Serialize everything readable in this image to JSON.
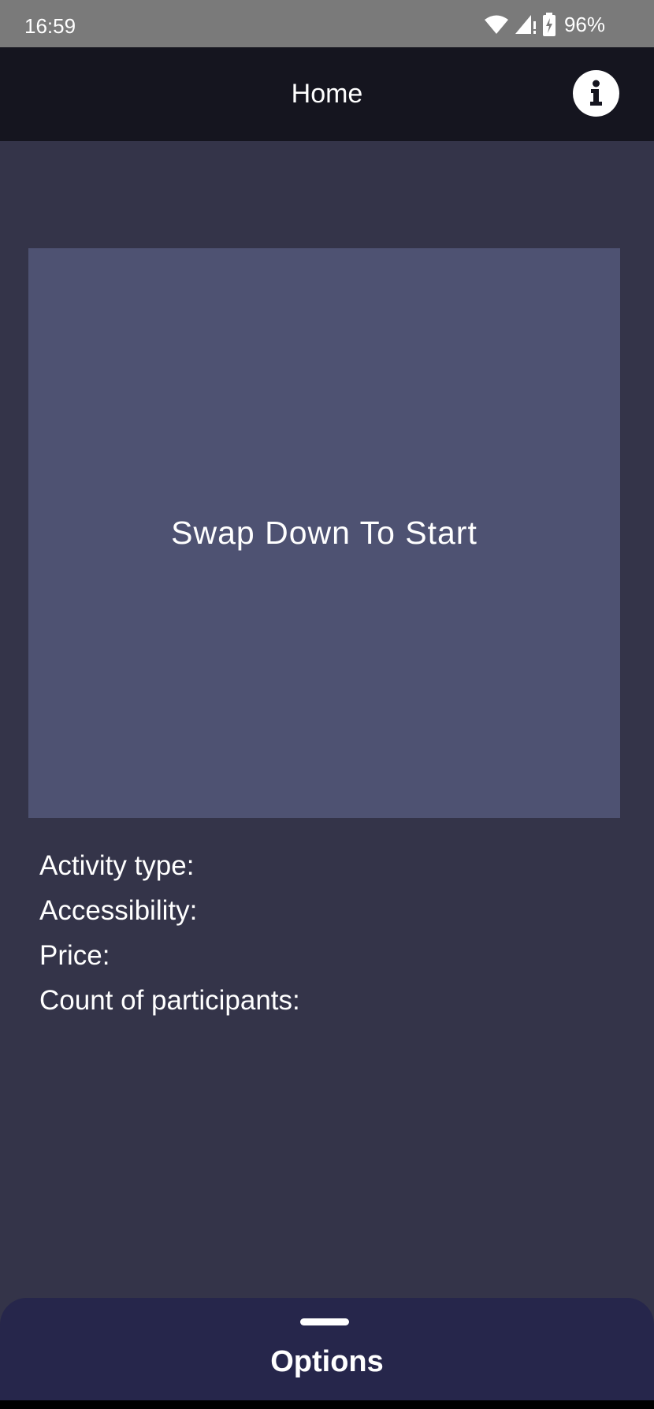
{
  "status_bar": {
    "time": "16:59",
    "battery_percent": "96%",
    "icons": [
      "wifi-icon",
      "cell-signal-icon",
      "battery-charging-icon"
    ]
  },
  "app_bar": {
    "title": "Home",
    "info_icon": "info-icon"
  },
  "card": {
    "prompt": "Swap Down To Start"
  },
  "details": {
    "activity_type": "Activity type:",
    "accessibility": "Accessibility:",
    "price": "Price:",
    "participants": "Count of participants:"
  },
  "bottom_sheet": {
    "title": "Options"
  },
  "colors": {
    "background": "#343449",
    "app_bar": "#15151f",
    "card": "#4e5272",
    "bottom_sheet": "#26264b",
    "status_bar": "#7a7a7a"
  }
}
